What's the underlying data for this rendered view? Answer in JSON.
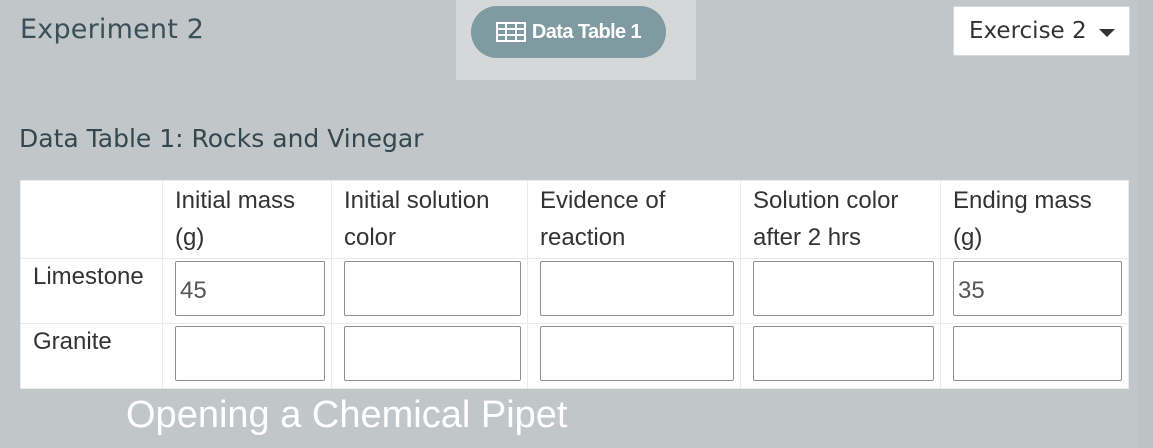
{
  "header": {
    "experiment_title": "Experiment 2",
    "tab_label": "Data Table 1",
    "tab_icon": "table-icon",
    "exercise_select": {
      "selected": "Exercise 2"
    }
  },
  "table": {
    "title": "Data Table 1: Rocks and Vinegar",
    "columns": [
      {
        "line1": "Initial mass",
        "line2": "(g)"
      },
      {
        "line1": "Initial solution",
        "line2": "color"
      },
      {
        "line1": "Evidence of",
        "line2": "reaction"
      },
      {
        "line1": "Solution color",
        "line2": "after 2 hrs"
      },
      {
        "line1": "Ending mass",
        "line2": "(g)"
      }
    ],
    "rows": [
      {
        "label": "Limestone",
        "values": [
          "45",
          "",
          "",
          "",
          "35"
        ]
      },
      {
        "label": "Granite",
        "values": [
          "",
          "",
          "",
          "",
          ""
        ]
      }
    ]
  },
  "caption": "Opening a Chemical Pipet",
  "colors": {
    "background": "#c1c6c8",
    "tab_pill": "#7f9aa0",
    "title_text": "#3a4f58"
  }
}
